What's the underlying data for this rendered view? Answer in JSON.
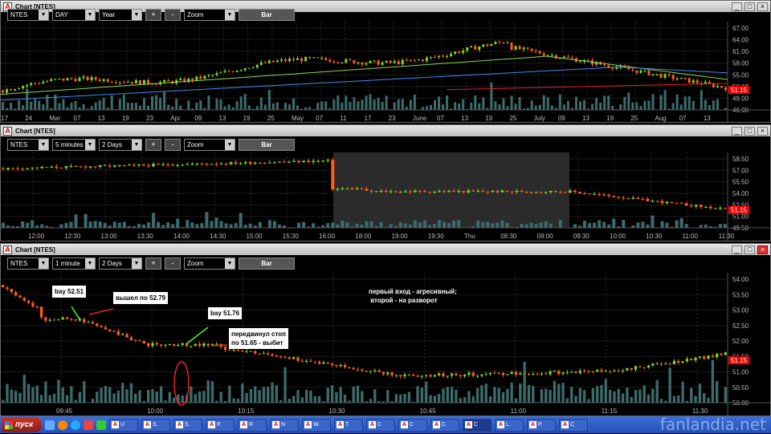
{
  "windows": [
    {
      "title": "Chart [NTES]",
      "symbol": "NTES",
      "interval": "DAY",
      "range": "Year",
      "zoom": "Zoom",
      "bar": "Bar",
      "prices": [
        "67.00",
        "64.00",
        "61.00",
        "58.00",
        "55.00",
        "52.00",
        "49.00",
        "46.00"
      ],
      "last": "51.15",
      "dates": [
        "17",
        "24",
        "Mar",
        "07",
        "13",
        "19",
        "23",
        "Apr",
        "09",
        "13",
        "19",
        "25",
        "May",
        "07",
        "11",
        "17",
        "23",
        "June",
        "07",
        "13",
        "19",
        "25",
        "July",
        "09",
        "13",
        "19",
        "25",
        "Aug",
        "07",
        "13"
      ]
    },
    {
      "title": "Chart [NTES]",
      "symbol": "NTES",
      "interval": "5 minutes",
      "range": "2 Days",
      "zoom": "Zoom",
      "bar": "Bar",
      "prices": [
        "58.50",
        "57.00",
        "55.50",
        "54.00",
        "52.50",
        "51.00",
        "49.50"
      ],
      "last": "51.15",
      "times": [
        "12:00",
        "12:30",
        "13:00",
        "13:30",
        "14:00",
        "14:30",
        "15:00",
        "15:30",
        "16:00",
        "18:00",
        "19:00",
        "19:30",
        "Thu",
        "08:30",
        "09:00",
        "09:30",
        "10:00",
        "10:30",
        "11:00",
        "11:30"
      ]
    },
    {
      "title": "Chart [NTES]",
      "symbol": "NTES",
      "interval": "1 minute",
      "range": "2 Days",
      "zoom": "Zoom",
      "bar": "Bar",
      "prices": [
        "54.00",
        "53.50",
        "53.00",
        "52.50",
        "52.00",
        "51.50",
        "51.00",
        "50.50",
        "50.00"
      ],
      "last": "51.15",
      "times": [
        "09:45",
        "10:00",
        "10:15",
        "10:30",
        "10:45",
        "11:00",
        "11:15",
        "11:30"
      ],
      "notes": {
        "buy1": "bay 52.51",
        "exit": "вышел по 52.79",
        "buy2": "bay 51.76",
        "stop": "передвинул стоп\nпо 51.65 - выбит",
        "comment": "первый вход - агресивный;\n второй - на разворот"
      }
    }
  ],
  "taskbar": {
    "start": "пуск",
    "items": [
      "U",
      "S.",
      "S.",
      "P.",
      "R",
      "N",
      "W.",
      "T.",
      "C",
      "C",
      "C",
      "C",
      "L.",
      "P.",
      "C"
    ]
  },
  "watermark": "fanlandia.net"
}
